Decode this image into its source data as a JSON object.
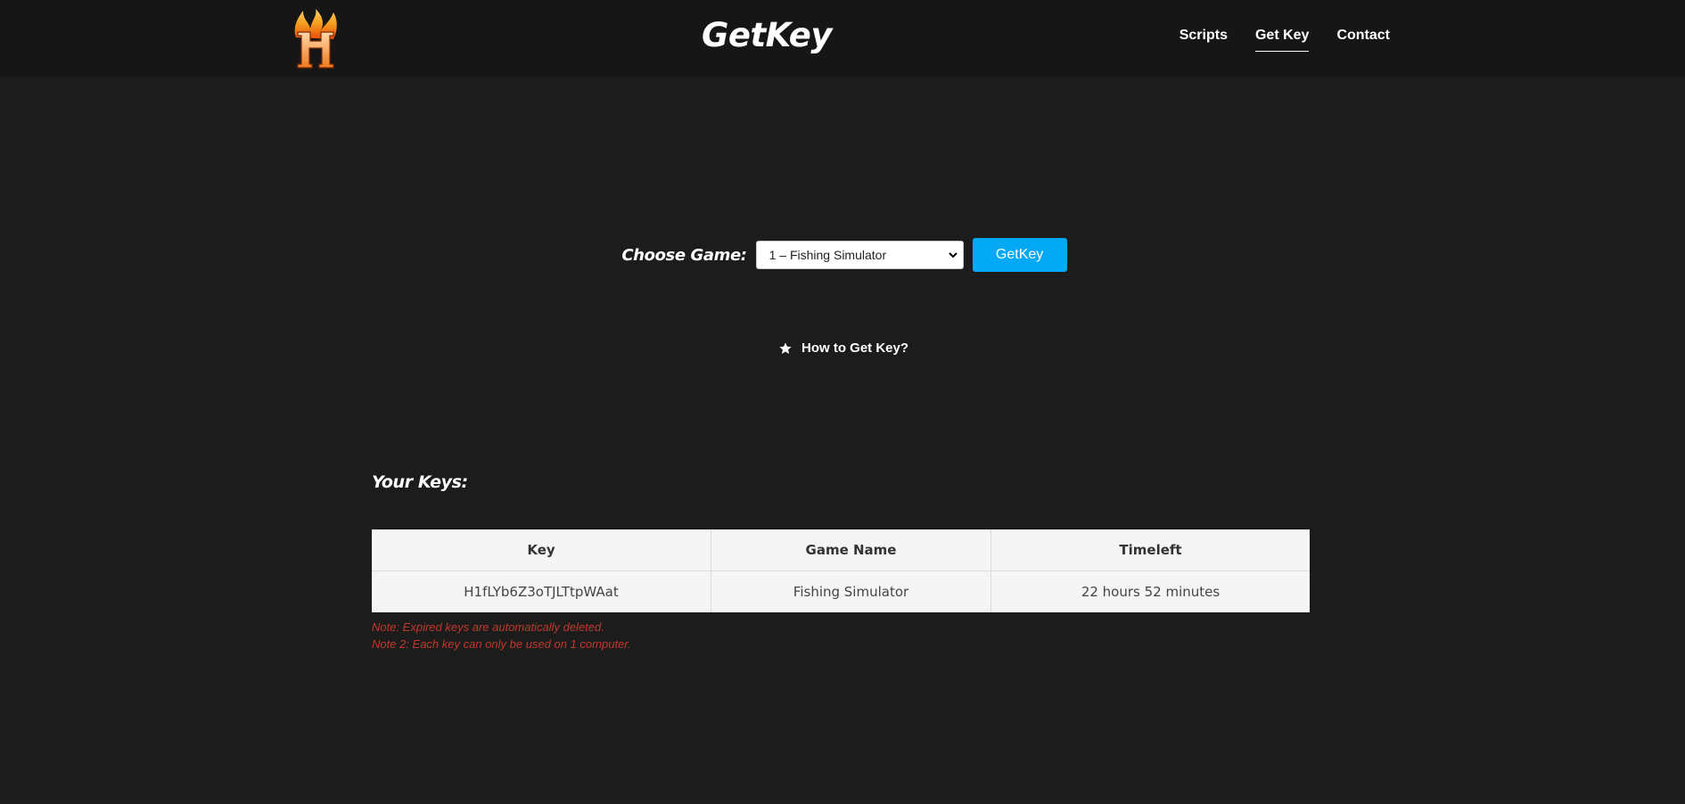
{
  "header": {
    "site_title": "GetKey",
    "logo_letter": "H",
    "nav": [
      {
        "label": "Scripts",
        "active": false
      },
      {
        "label": "Get Key",
        "active": true
      },
      {
        "label": "Contact",
        "active": false
      }
    ]
  },
  "form": {
    "choose_label": "Choose Game:",
    "selected_game": "1 – Fishing Simulator",
    "button_label": "GetKey",
    "button_color": "#03a9f4"
  },
  "howto": {
    "icon": "star-icon",
    "label": "How to Get Key?"
  },
  "keys": {
    "title": "Your Keys:",
    "columns": [
      "Key",
      "Game Name",
      "Timeleft"
    ],
    "rows": [
      [
        "H1fLYb6Z3oTJLTtpWAat",
        "Fishing Simulator",
        "22 hours 52 minutes"
      ]
    ],
    "notes": [
      "Note: Expired keys are automatically deleted.",
      "Note 2: Each key can only be used on 1 computer."
    ],
    "note_color": "#c0392b"
  }
}
